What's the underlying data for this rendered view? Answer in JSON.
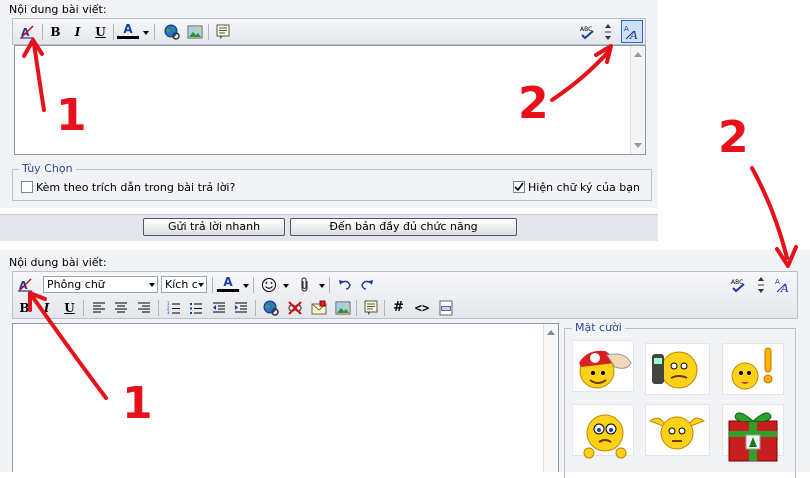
{
  "top_panel": {
    "label": "Nội dung bài viết:",
    "options_legend": "Tùy Chọn",
    "quote_option": "Kèm theo trích dẫn trong bài trả lời?",
    "signature_option": "Hiện chữ ký của bạn",
    "quote_checked": false,
    "signature_checked": true,
    "quick_reply_button": "Gửi trả lời nhanh",
    "full_editor_button": "Đến bản đầy đủ chức năng"
  },
  "bottom_panel": {
    "label": "Nội dung bài viết:",
    "font_select": "Phông chữ",
    "size_select": "Kích c",
    "smilies_legend": "Mặt cười"
  },
  "toolbar_glyphs": {
    "bold": "B",
    "italic": "I",
    "underline": "U",
    "font_color": "A",
    "hash": "#",
    "code": "<>",
    "spell": "ABC",
    "switch_mode": "A",
    "switch_mode_small": "A"
  },
  "annotations": {
    "num1": "1",
    "num2": "2"
  },
  "colors": {
    "panel_bg": "#f1f3f6",
    "annotation": "#e8101a",
    "legend_blue": "#2d4d8f",
    "toolbar_border": "#b9c2cc"
  },
  "icons": [
    "remove-format-icon",
    "globe-link-icon",
    "image-icon",
    "quote-icon",
    "spellcheck-icon",
    "resize-icon",
    "switch-mode-icon",
    "smiley-icon",
    "attach-icon",
    "undo-icon",
    "redo-icon",
    "align-left-icon",
    "align-center-icon",
    "align-right-icon",
    "ordered-list-icon",
    "unordered-list-icon",
    "outdent-icon",
    "indent-icon",
    "unlink-icon",
    "email-icon",
    "hash-icon",
    "code-icon",
    "php-icon"
  ]
}
